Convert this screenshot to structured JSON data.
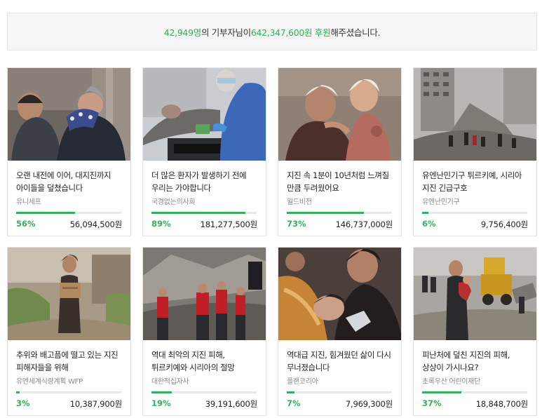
{
  "summary": {
    "donors": "42,949명",
    "text1": "의 기부자님이 ",
    "total": "642,347,600원 후원",
    "text2": "해주셨습니다."
  },
  "cards": [
    {
      "title": "오랜 내전에 이어, 대지진까지 아이들을 덮쳤습니다",
      "org": "유니세프",
      "percent": "56%",
      "progress": 0.56,
      "amount": "56,094,500원",
      "image": "father-child-photo"
    },
    {
      "title": "더 많은 환자가 발생하기 전에 우리는 가야합니다",
      "org": "국경없는의사회",
      "percent": "89%",
      "progress": 0.89,
      "amount": "181,277,500원",
      "image": "medic-patient-photo"
    },
    {
      "title": "지진 속 1분이 10년처럼 느껴질 만큼 두려웠어요",
      "org": "월드비전",
      "percent": "73%",
      "progress": 0.73,
      "amount": "146,737,000원",
      "image": "injured-child-photo"
    },
    {
      "title": "유엔난민기구 튀르키예, 시리아 지진 긴급구호",
      "org": "유엔난민기구",
      "percent": "6%",
      "progress": 0.06,
      "amount": "9,756,400원",
      "image": "collapsed-building-photo"
    },
    {
      "title": "추위와 배고픔에 떨고 있는 지진 피해자들을 위해",
      "org": "유엔세계식량계획 WFP",
      "percent": "3%",
      "progress": 0.03,
      "amount": "10,387,900원",
      "image": "woman-carrying-box-photo"
    },
    {
      "title": "역대 최악의 지진 피해, 튀르키예와 시리아의 절망",
      "org": "대한적십자사",
      "percent": "19%",
      "progress": 0.19,
      "amount": "39,191,600원",
      "image": "red-cross-rescuers-photo"
    },
    {
      "title": "역대급 지진, 힘겨웠던 삶이 다시 무너졌습니다",
      "org": "플랜코리아",
      "percent": "7%",
      "progress": 0.07,
      "amount": "7,969,300원",
      "image": "rescued-girl-photo"
    },
    {
      "title": "피난처에 덮친 지진의 피해, 상상이 가시나요?",
      "org": "초록우산 어린이재단",
      "percent": "37%",
      "progress": 0.37,
      "amount": "18,848,700원",
      "image": "man-carrying-child-photo"
    }
  ],
  "colors": {
    "accent": "#32b05a",
    "track": "#e9e9e9"
  }
}
